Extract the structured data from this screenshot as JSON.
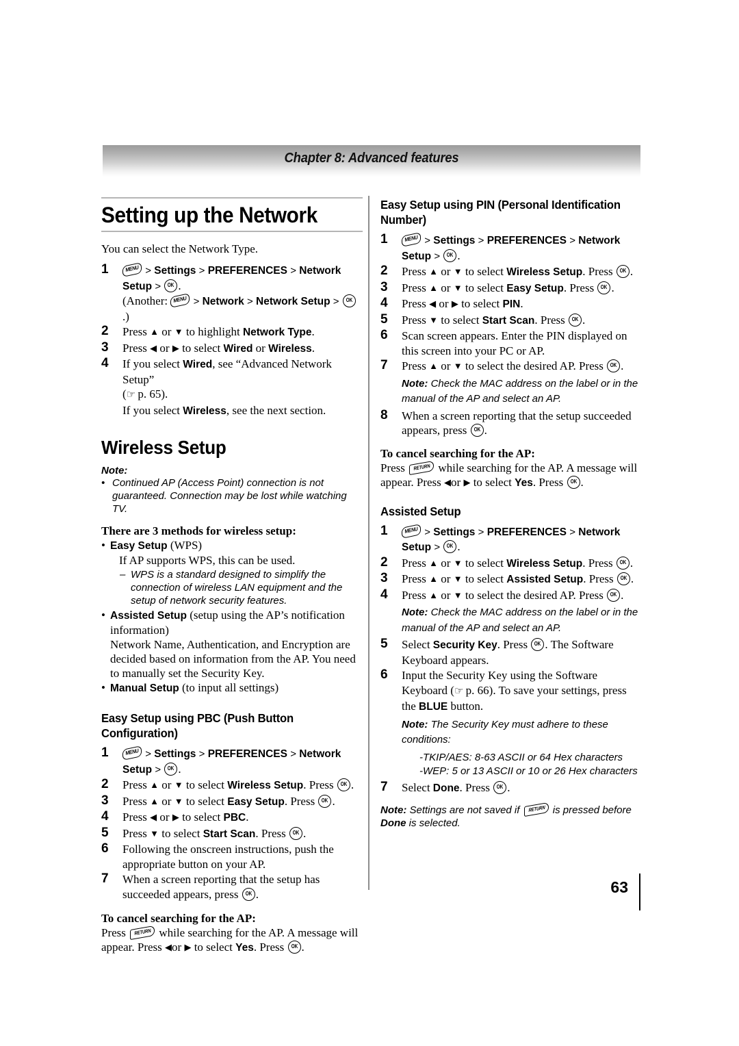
{
  "chapter": {
    "title": "Chapter 8: Advanced features"
  },
  "page": {
    "number": "63"
  },
  "icons": {
    "menu": "MENU",
    "ok": "OK",
    "return": "RETURN",
    "hand": "☞",
    "up": "▲",
    "down": "▼",
    "left": "◀",
    "right": "▶",
    "gt": ">"
  },
  "left_column": {
    "h1": "Setting up the Network",
    "intro": "You can select the Network Type.",
    "steps": [
      {
        "num": "1",
        "line1_a": "Settings",
        "line1_b": "PREFERENCES",
        "line1_c": "Network Setup",
        "line2": "(Another:",
        "line2_b": "Network",
        "line2_c": "Network Setup",
        "line2_end": ".)"
      },
      {
        "num": "2",
        "text_a": "Press",
        "text_b": "or",
        "text_c": "to highlight",
        "bold": "Network Type",
        "text_end": "."
      },
      {
        "num": "3",
        "text_a": "Press",
        "text_b": "or",
        "text_c": "to select",
        "bold": "Wired",
        "text_mid": "or",
        "bold2": "Wireless",
        "text_end": "."
      },
      {
        "num": "4",
        "line1_a": "If you select",
        "line1_bold": "Wired",
        "line1_b": ", see “Advanced Network Setup”",
        "line2_a": "(",
        "line2_b": "p. 65).",
        "line3_a": "If you select",
        "line3_bold": "Wireless",
        "line3_b": ", see the next section."
      }
    ],
    "h2": "Wireless Setup",
    "note_label": "Note:",
    "note_bullets": [
      "Continued AP (Access Point) connection is not guaranteed. Connection may be lost while watching TV."
    ],
    "methods_heading": "There are 3 methods for wireless setup:",
    "methods": [
      {
        "bold": "Easy Setup",
        "plain": "(WPS)",
        "sub": "If AP supports WPS, this can be used.",
        "dash": "WPS is a standard designed to simplify the connection of wireless LAN equipment and the setup of network security features."
      },
      {
        "bold": "Assisted Setup",
        "plain": "(setup using the AP’s notification information)",
        "sub": "Network Name, Authentication, and Encryption are decided based on information from the AP. You need to manually set the Security Key."
      },
      {
        "bold": "Manual Setup",
        "plain": "(to input all settings)"
      }
    ],
    "h3_pbc": "Easy Setup using PBC (Push Button Configuration)",
    "pbc_steps": [
      {
        "num": "1",
        "line1_a": "Settings",
        "line1_b": "PREFERENCES",
        "line1_c": "Network Setup"
      },
      {
        "num": "2",
        "text_a": "Press",
        "text_b": "or",
        "text_c": "to select",
        "bold": "Wireless Setup",
        "text_d": ". Press"
      },
      {
        "num": "3",
        "text_a": "Press",
        "text_b": "or",
        "text_c": "to select",
        "bold": "Easy Setup",
        "text_d": ". Press"
      },
      {
        "num": "4",
        "text_a": "Press",
        "text_b": "or",
        "text_c": "to select",
        "bold": "PBC",
        "text_d": "."
      },
      {
        "num": "5",
        "text_a": "Press",
        "text_c": "to select",
        "bold": "Start Scan",
        "text_d": ". Press"
      },
      {
        "num": "6",
        "plain": "Following the onscreen instructions, push the appropriate button on your AP."
      },
      {
        "num": "7",
        "text_a": "When a screen reporting that the setup has succeeded appears, press",
        "text_d": "."
      }
    ],
    "cancel_heading": "To cancel searching for the AP:",
    "cancel_a": "Press",
    "cancel_b": "while searching for the AP. A message will appear. Press",
    "cancel_c": "or",
    "cancel_d": "to select",
    "cancel_bold": "Yes",
    "cancel_e": ". Press"
  },
  "right_column": {
    "h3_pin": "Easy Setup using PIN (Personal Identification Number)",
    "pin_steps": [
      {
        "num": "1",
        "line1_a": "Settings",
        "line1_b": "PREFERENCES",
        "line1_c": "Network Setup"
      },
      {
        "num": "2",
        "text_a": "Press",
        "text_b": "or",
        "text_c": "to select",
        "bold": "Wireless Setup",
        "text_d": ". Press"
      },
      {
        "num": "3",
        "text_a": "Press",
        "text_b": "or",
        "text_c": "to select",
        "bold": "Easy Setup",
        "text_d": ". Press"
      },
      {
        "num": "4",
        "text_a": "Press",
        "text_b": "or",
        "text_c": "to select",
        "bold": "PIN",
        "text_d": "."
      },
      {
        "num": "5",
        "text_a": "Press",
        "text_c": "to select",
        "bold": "Start Scan",
        "text_d": ". Press"
      },
      {
        "num": "6",
        "plain": "Scan screen appears. Enter the PIN displayed on this screen into your PC or AP."
      },
      {
        "num": "7",
        "text_a": "Press",
        "text_b": "or",
        "text_c": "to select the desired AP. Press",
        "text_d": ".",
        "note_label": "Note:",
        "note_text": "Check the MAC address on the label or in the manual of the AP and select an AP."
      },
      {
        "num": "8",
        "text_a": "When a screen reporting that the setup succeeded appears, press",
        "text_d": "."
      }
    ],
    "cancel_heading": "To cancel searching for the AP:",
    "cancel_a": "Press",
    "cancel_b": "while searching for the AP. A message will appear. Press",
    "cancel_c": "or",
    "cancel_d": "to select",
    "cancel_bold": "Yes",
    "cancel_e": ". Press",
    "h3_assisted": "Assisted Setup",
    "assisted_steps": [
      {
        "num": "1",
        "line1_a": "Settings",
        "line1_b": "PREFERENCES",
        "line1_c": "Network Setup"
      },
      {
        "num": "2",
        "text_a": "Press",
        "text_b": "or",
        "text_c": "to select",
        "bold": "Wireless Setup",
        "text_d": ". Press"
      },
      {
        "num": "3",
        "text_a": "Press",
        "text_b": "or",
        "text_c": "to select",
        "bold": "Assisted Setup",
        "text_d": ". Press"
      },
      {
        "num": "4",
        "text_a": "Press",
        "text_b": "or",
        "text_c": "to select the desired AP. Press",
        "text_d": ".",
        "note_label": "Note:",
        "note_text": "Check the MAC address on the label or in the manual of the AP and select an AP."
      },
      {
        "num": "5",
        "text_a": "Select",
        "bold": "Security Key",
        "text_c": ". Press",
        "text_d": ". The Software Keyboard appears."
      },
      {
        "num": "6",
        "text_a": "Input the Security Key using the Software Keyboard (",
        "text_b": "p. 66). To save your settings, press the",
        "bold": "BLUE",
        "text_c": "button.",
        "note_label": "Note:",
        "note_text": "The Security Key must adhere to these conditions:",
        "conditions": [
          "-TKIP/AES: 8-63 ASCII or 64 Hex characters",
          "-WEP: 5 or 13 ASCII or 10 or 26 Hex characters"
        ]
      },
      {
        "num": "7",
        "text_a": "Select",
        "bold": "Done",
        "text_c": ". Press",
        "text_d": "."
      }
    ],
    "final_note_label": "Note:",
    "final_note_a": "Settings are not saved if",
    "final_note_b": "is pressed before",
    "final_note_bold": "Done",
    "final_note_c": "is selected."
  }
}
